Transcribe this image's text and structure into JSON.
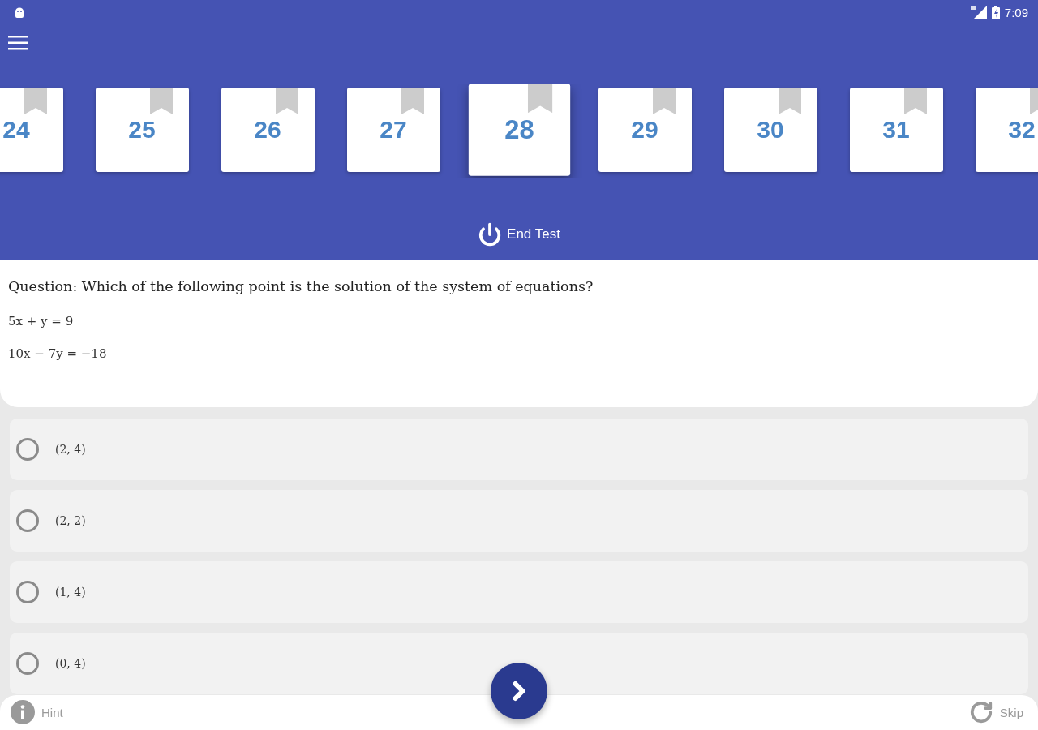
{
  "status_bar": {
    "time": "7:09"
  },
  "question_cards": [
    {
      "number": "24",
      "selected": false,
      "bookmarked": false
    },
    {
      "number": "25",
      "selected": false,
      "bookmarked": false
    },
    {
      "number": "26",
      "selected": false,
      "bookmarked": false
    },
    {
      "number": "27",
      "selected": false,
      "bookmarked": false
    },
    {
      "number": "28",
      "selected": true,
      "bookmarked": false
    },
    {
      "number": "29",
      "selected": false,
      "bookmarked": false
    },
    {
      "number": "30",
      "selected": false,
      "bookmarked": false
    },
    {
      "number": "31",
      "selected": false,
      "bookmarked": false
    },
    {
      "number": "32",
      "selected": false,
      "bookmarked": false
    }
  ],
  "end_test": {
    "label": "End Test"
  },
  "question": {
    "text": "Question: Which of the following point is the solution of the system of equations?",
    "equations": [
      "5x + y = 9",
      "10x − 7y = −18"
    ]
  },
  "options": [
    {
      "label": "(2, 4)",
      "selected": false
    },
    {
      "label": "(2, 2)",
      "selected": false
    },
    {
      "label": "(1, 4)",
      "selected": false
    },
    {
      "label": "(0, 4)",
      "selected": false
    }
  ],
  "footer": {
    "hint": "Hint",
    "skip": "Skip"
  }
}
